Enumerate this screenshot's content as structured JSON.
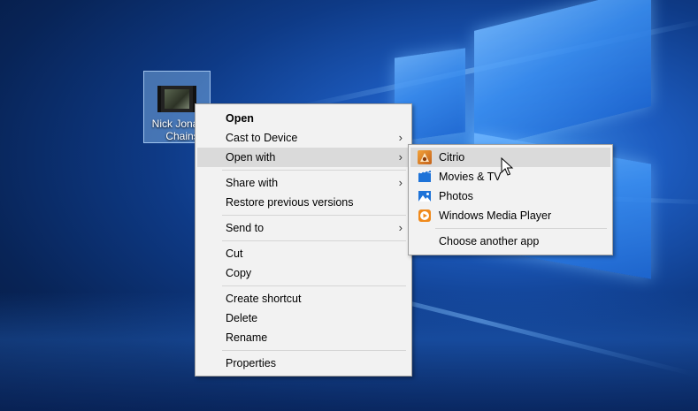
{
  "desktop_icon": {
    "label_line1": "Nick Jonas",
    "label_line2": "Chains",
    "type": "video-file"
  },
  "context_menu": {
    "items": [
      {
        "label": "Open",
        "bold": true
      },
      {
        "label": "Cast to Device",
        "submenu": true
      },
      {
        "label": "Open with",
        "submenu": true,
        "hover": true
      },
      {
        "label": "Share with",
        "submenu": true
      },
      {
        "label": "Restore previous versions"
      },
      {
        "label": "Send to",
        "submenu": true
      },
      {
        "label": "Cut"
      },
      {
        "label": "Copy"
      },
      {
        "label": "Create shortcut"
      },
      {
        "label": "Delete"
      },
      {
        "label": "Rename"
      },
      {
        "label": "Properties"
      }
    ],
    "chevron": "›"
  },
  "open_with_menu": {
    "items": [
      {
        "label": "Citrio",
        "icon": "citrio-icon",
        "hover": true
      },
      {
        "label": "Movies & TV",
        "icon": "movies-tv-icon"
      },
      {
        "label": "Photos",
        "icon": "photos-icon"
      },
      {
        "label": "Windows Media Player",
        "icon": "windows-media-player-icon"
      },
      {
        "label": "Choose another app"
      }
    ]
  },
  "colors": {
    "menu_bg": "#f2f2f2",
    "hover_bg": "#dadada",
    "desktop_accent": "#1d5cc0"
  }
}
